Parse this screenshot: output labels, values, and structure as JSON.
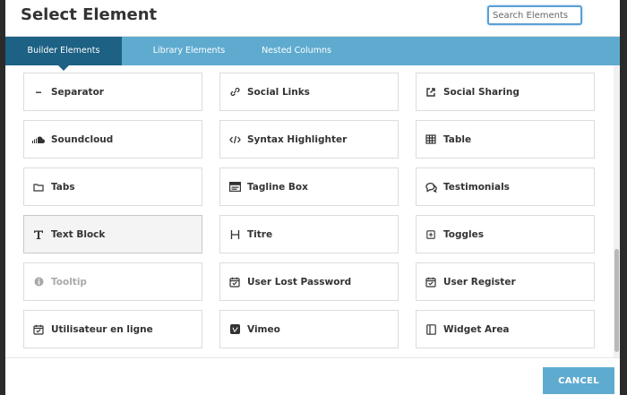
{
  "header": {
    "title": "Select Element",
    "search_placeholder": "Search Elements"
  },
  "tabs": [
    {
      "label": "Builder Elements",
      "active": true
    },
    {
      "label": "Library Elements",
      "active": false
    },
    {
      "label": "Nested Columns",
      "active": false
    }
  ],
  "elements": [
    {
      "label": "Separator",
      "icon": "separator-icon"
    },
    {
      "label": "Social Links",
      "icon": "link-icon"
    },
    {
      "label": "Social Sharing",
      "icon": "share-icon"
    },
    {
      "label": "Soundcloud",
      "icon": "soundcloud-icon"
    },
    {
      "label": "Syntax Highlighter",
      "icon": "code-icon"
    },
    {
      "label": "Table",
      "icon": "table-icon"
    },
    {
      "label": "Tabs",
      "icon": "folder-icon"
    },
    {
      "label": "Tagline Box",
      "icon": "tagline-box-icon"
    },
    {
      "label": "Testimonials",
      "icon": "speech-bubble-icon"
    },
    {
      "label": "Text Block",
      "icon": "text-icon",
      "selected": true
    },
    {
      "label": "Titre",
      "icon": "heading-icon"
    },
    {
      "label": "Toggles",
      "icon": "plus-square-icon"
    },
    {
      "label": "Tooltip",
      "icon": "info-circle-icon",
      "disabled": true
    },
    {
      "label": "User Lost Password",
      "icon": "calendar-check-icon"
    },
    {
      "label": "User Register",
      "icon": "calendar-check-icon"
    },
    {
      "label": "Utilisateur en ligne",
      "icon": "calendar-check-icon"
    },
    {
      "label": "Vimeo",
      "icon": "vimeo-icon"
    },
    {
      "label": "Widget Area",
      "icon": "widget-area-icon"
    }
  ],
  "footer": {
    "cancel_label": "CANCEL"
  },
  "colors": {
    "accent": "#5fabd0",
    "active_tab": "#1d6184",
    "text": "#333333",
    "disabled_text": "#a9a9a9"
  }
}
